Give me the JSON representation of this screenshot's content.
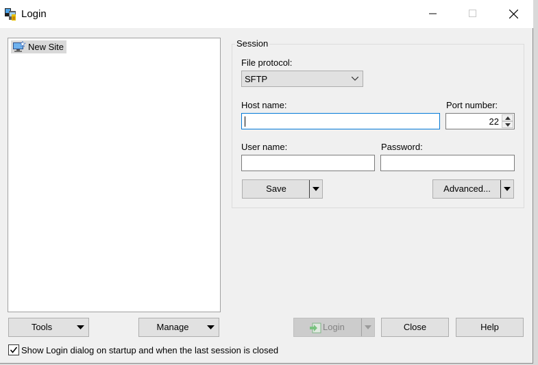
{
  "window": {
    "title": "Login"
  },
  "site_tree": {
    "items": [
      {
        "label": "New Site",
        "icon": "monitor-star-icon"
      }
    ]
  },
  "session": {
    "group_label": "Session",
    "file_protocol_label": "File protocol:",
    "file_protocol_value": "SFTP",
    "host_name_label": "Host name:",
    "host_name_value": "",
    "port_number_label": "Port number:",
    "port_number_value": "22",
    "user_name_label": "User name:",
    "user_name_value": "",
    "password_label": "Password:",
    "password_value": "",
    "save_label": "Save",
    "advanced_label": "Advanced..."
  },
  "buttons": {
    "tools": "Tools",
    "manage": "Manage",
    "login": "Login",
    "close": "Close",
    "help": "Help"
  },
  "footer": {
    "show_login_label": "Show Login dialog on startup and when the last session is closed",
    "show_login_checked": true
  },
  "colors": {
    "focus": "#0078d7",
    "button_bg": "#e1e1e1",
    "selection_bg": "#d9d9d9",
    "login_icon": "#2fae3a"
  }
}
